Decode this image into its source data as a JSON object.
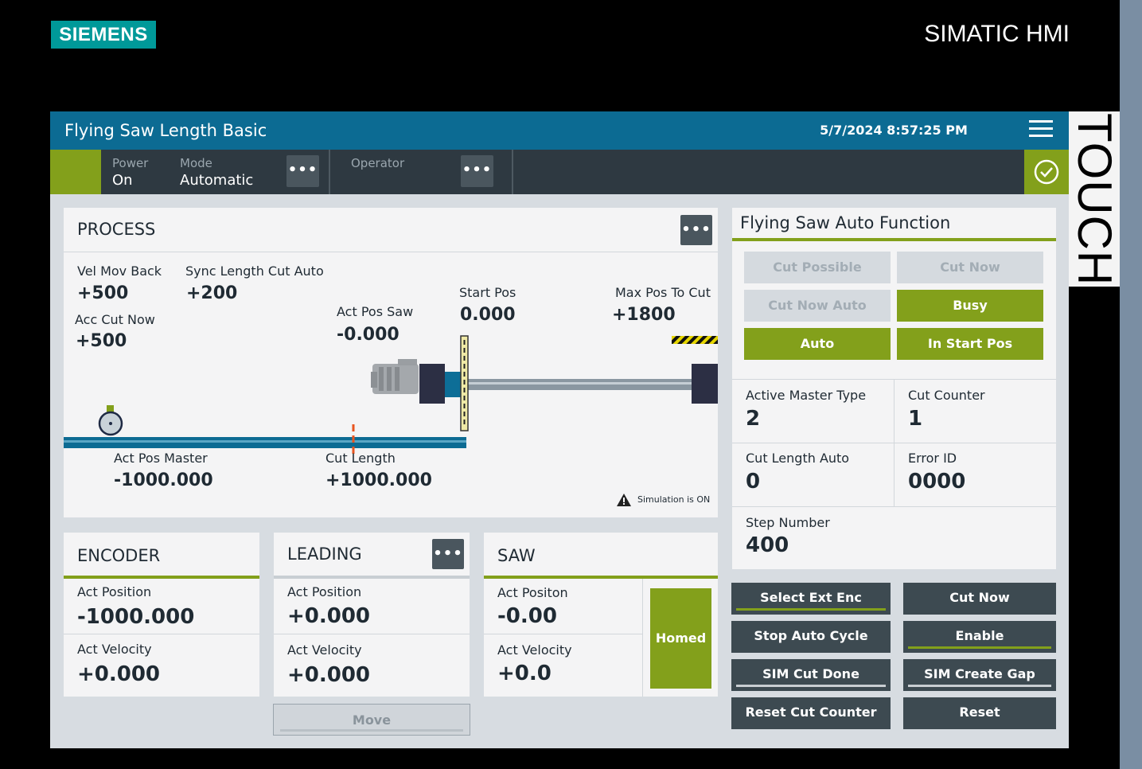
{
  "bezel": {
    "logo": "SIEMENS",
    "brand": "SIMATIC HMI",
    "touch": "TOUCH"
  },
  "header": {
    "title": "Flying Saw Length Basic",
    "datetime": "5/7/2024 8:57:25 PM"
  },
  "status": {
    "power_label": "Power",
    "power_value": "On",
    "mode_label": "Mode",
    "mode_value": "Automatic",
    "operator_label": "Operator",
    "more_button": "•••"
  },
  "process": {
    "title": "PROCESS",
    "vel_mov_back_label": "Vel Mov Back",
    "vel_mov_back": "+500",
    "sync_length_label": "Sync Length Cut Auto",
    "sync_length": "+200",
    "acc_cut_now_label": "Acc Cut Now",
    "acc_cut_now": "+500",
    "act_pos_saw_label": "Act Pos Saw",
    "act_pos_saw": "-0.000",
    "start_pos_label": "Start Pos",
    "start_pos": "0.000",
    "max_pos_label": "Max Pos To Cut",
    "max_pos": "+1800",
    "act_pos_master_label": "Act Pos Master",
    "act_pos_master": "-1000.000",
    "cut_length_label": "Cut Length",
    "cut_length": "+1000.000",
    "simulation_note": "Simulation is ON"
  },
  "encoder": {
    "title": "ENCODER",
    "act_position_label": "Act Position",
    "act_position": "-1000.000",
    "act_velocity_label": "Act Velocity",
    "act_velocity": "+0.000"
  },
  "leading": {
    "title": "LEADING",
    "act_position_label": "Act Position",
    "act_position": "+0.000",
    "act_velocity_label": "Act Velocity",
    "act_velocity": "+0.000",
    "move_button": "Move"
  },
  "saw": {
    "title": "SAW",
    "act_position_label": "Act Positon",
    "act_position": "-0.00",
    "act_velocity_label": "Act Velocity",
    "act_velocity": "+0.0",
    "homed": "Homed"
  },
  "auto_function": {
    "title": "Flying Saw Auto Function",
    "indicators": [
      {
        "label": "Cut Possible",
        "active": false
      },
      {
        "label": "Cut Now",
        "active": false
      },
      {
        "label": "Cut Now Auto",
        "active": false
      },
      {
        "label": "Busy",
        "active": true
      },
      {
        "label": "Auto",
        "active": true
      },
      {
        "label": "In Start Pos",
        "active": true
      }
    ],
    "active_master_type_label": "Active Master Type",
    "active_master_type": "2",
    "cut_counter_label": "Cut Counter",
    "cut_counter": "1",
    "cut_length_auto_label": "Cut Length Auto",
    "cut_length_auto": "0",
    "error_id_label": "Error ID",
    "error_id": "0000",
    "step_number_label": "Step Number",
    "step_number": "400"
  },
  "commands": {
    "select_ext_enc": "Select Ext Enc",
    "cut_now": "Cut Now",
    "stop_auto_cycle": "Stop Auto Cycle",
    "enable": "Enable",
    "sim_cut_done": "SIM Cut Done",
    "sim_create_gap": "SIM Create Gap",
    "reset_cut_counter": "Reset Cut Counter",
    "reset": "Reset"
  },
  "colors": {
    "title_bar": "#0c6b93",
    "status_bar": "#2e3941",
    "accent_green": "#83a01b",
    "command_button": "#3d4a51",
    "siemens_teal": "#009999",
    "warning_orange": "#e8551f"
  }
}
